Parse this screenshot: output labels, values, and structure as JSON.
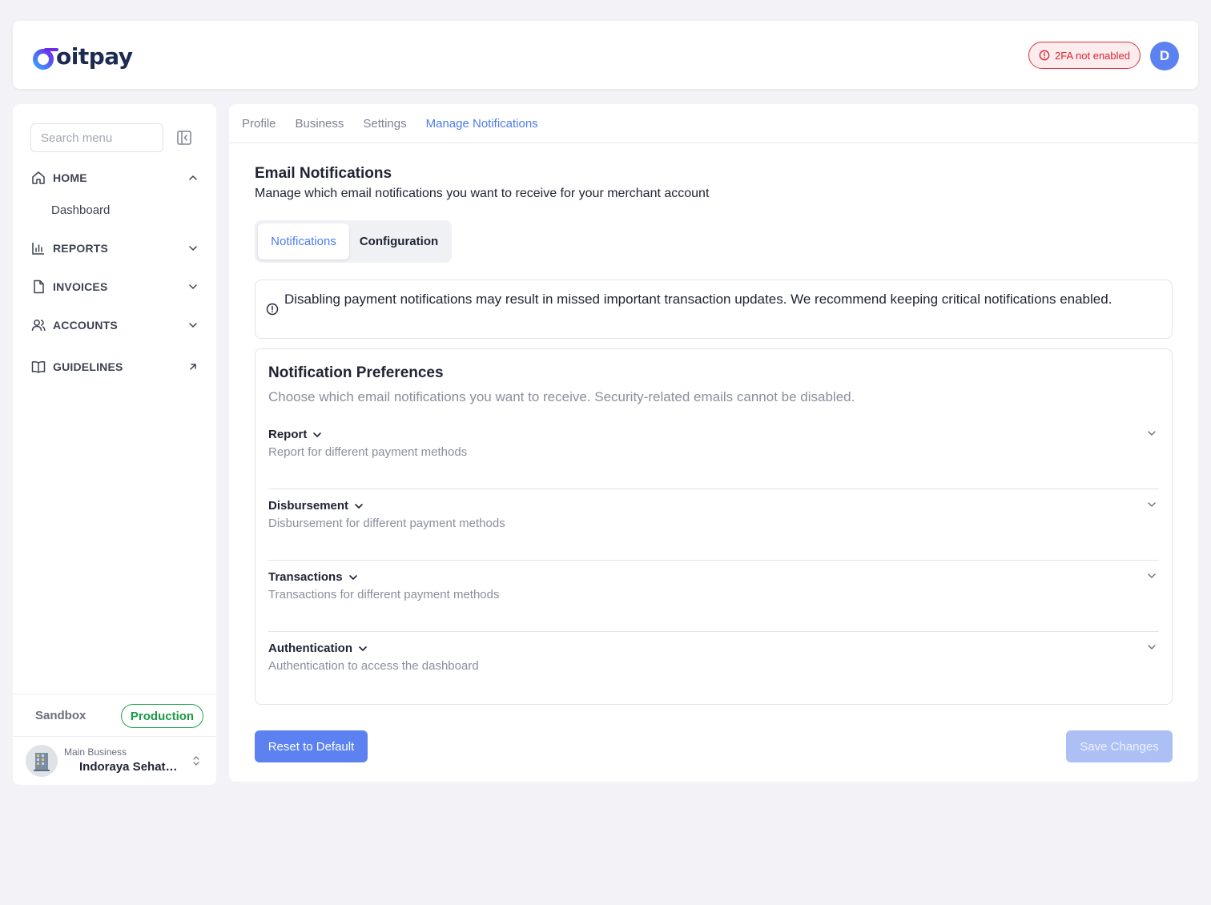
{
  "header": {
    "logo_text": "oitpay",
    "twofa_badge": "2FA not enabled",
    "avatar_initial": "D",
    "colors": {
      "brand": "#4b7bec",
      "danger": "#d7262f"
    }
  },
  "sidebar": {
    "search_placeholder": "Search menu",
    "items": [
      {
        "label": "HOME",
        "icon": "home-icon",
        "chevron": "up"
      },
      {
        "label": "REPORTS",
        "icon": "bar-chart-icon",
        "chevron": "down"
      },
      {
        "label": "INVOICES",
        "icon": "document-icon",
        "chevron": "down"
      },
      {
        "label": "ACCOUNTS",
        "icon": "users-icon",
        "chevron": "down"
      },
      {
        "label": "GUIDELINES",
        "icon": "book-icon",
        "chevron": "external"
      }
    ],
    "home_sub": "Dashboard",
    "env": {
      "sandbox": "Sandbox",
      "production": "Production",
      "active": "production"
    },
    "business": {
      "label": "Main Business",
      "name": "Indoraya Sehatindo"
    }
  },
  "main": {
    "tabs": [
      "Profile",
      "Business",
      "Settings",
      "Manage Notifications"
    ],
    "active_tab": "Manage Notifications",
    "title": "Email Notifications",
    "subtitle": "Manage which email notifications you want to receive for your merchant account",
    "segments": {
      "notifications": "Notifications",
      "configuration": "Configuration",
      "active": "Notifications"
    },
    "alert": "Disabling payment notifications may result in missed important transaction updates. We recommend keeping critical notifications enabled.",
    "prefs": {
      "title": "Notification Preferences",
      "subtitle": "Choose which email notifications you want to receive. Security-related emails cannot be disabled.",
      "sections": [
        {
          "title": "Report",
          "desc": "Report for different payment methods"
        },
        {
          "title": "Disbursement",
          "desc": "Disbursement for different payment methods"
        },
        {
          "title": "Transactions",
          "desc": "Transactions for different payment methods"
        },
        {
          "title": "Authentication",
          "desc": "Authentication to access the dashboard"
        }
      ]
    },
    "buttons": {
      "reset": "Reset to Default",
      "save": "Save Changes"
    }
  }
}
